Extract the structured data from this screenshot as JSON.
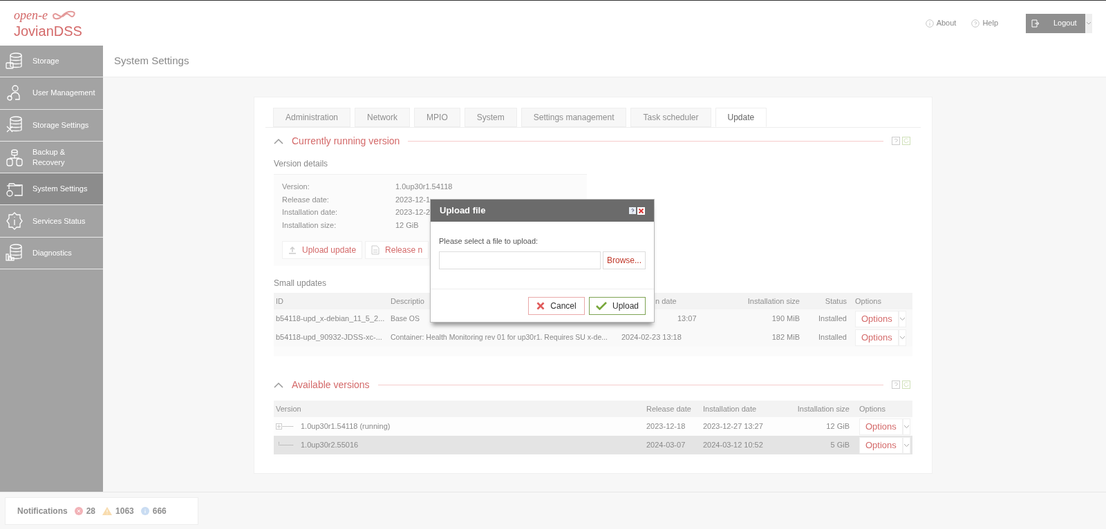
{
  "header": {
    "logo_top": "open-e",
    "logo_bottom": "JovianDSS",
    "links": [
      {
        "label": "About"
      },
      {
        "label": "Help"
      }
    ],
    "logout": "Logout"
  },
  "sidebar": {
    "items": [
      {
        "label": "Storage",
        "selected": false
      },
      {
        "label": "User Management",
        "selected": false
      },
      {
        "label": "Storage Settings",
        "selected": false
      },
      {
        "label": "Backup & Recovery",
        "selected": false
      },
      {
        "label": "System Settings",
        "selected": true
      },
      {
        "label": "Services Status",
        "selected": false
      },
      {
        "label": "Diagnostics",
        "selected": false
      }
    ]
  },
  "page_title": "System Settings",
  "tabs": [
    {
      "label": "Administration",
      "selected": false
    },
    {
      "label": "Network",
      "selected": false
    },
    {
      "label": "MPIO",
      "selected": false
    },
    {
      "label": "System",
      "selected": false
    },
    {
      "label": "Settings management",
      "selected": false
    },
    {
      "label": "Task scheduler",
      "selected": false
    },
    {
      "label": "Update",
      "selected": true
    }
  ],
  "running_section": {
    "title": "Currently running version",
    "expanded": true
  },
  "version_details": {
    "title": "Version details",
    "rows": [
      {
        "label": "Version:",
        "value": "1.0up30r1.54118"
      },
      {
        "label": "Release date:",
        "value": "2023-12-1"
      },
      {
        "label": "Installation date:",
        "value": "2023-12-2"
      },
      {
        "label": "Installation size:",
        "value": "12 GiB"
      }
    ],
    "buttons": [
      "Upload update",
      "Release n"
    ]
  },
  "small_updates": {
    "title": "Small updates",
    "columns": [
      "ID",
      "Descriptio",
      "n date",
      "Installation size",
      "Status",
      "Options"
    ],
    "rows": [
      {
        "id": "b54118-upd_x-debian_11_5_2...",
        "description": "Base OS",
        "installation_date": "13:07",
        "size": "190 MiB",
        "status": "Installed",
        "options": "Options"
      },
      {
        "id": "b54118-upd_90932-JDSS-xc-...",
        "description": "Container: Health Monitoring rev 01 for up30r1. Requires SU x-de...",
        "installation_date": "2024-02-23 13:18",
        "size": "182 MiB",
        "status": "Installed",
        "options": "Options"
      }
    ]
  },
  "available_section": {
    "title": "Available versions",
    "expanded": true
  },
  "available_versions": {
    "columns": [
      "Version",
      "Release date",
      "Installation date",
      "Installation size",
      "Options"
    ],
    "rows": [
      {
        "version": "1.0up30r1.54118 (running)",
        "release_date": "2023-12-18",
        "installation_date": "2023-12-27 13:27",
        "size": "12 GiB",
        "options": "Options",
        "expandable": true,
        "selected": false
      },
      {
        "version": "1.0up30r2.55016",
        "release_date": "2024-03-07",
        "installation_date": "2024-03-12 10:52",
        "size": "5 GiB",
        "options": "Options",
        "expandable": false,
        "selected": true
      }
    ]
  },
  "dialog": {
    "title": "Upload file",
    "label": "Please select a file to upload:",
    "browse": "Browse...",
    "cancel": "Cancel",
    "upload": "Upload"
  },
  "notifications": {
    "label": "Notifications",
    "counts": [
      {
        "kind": "error",
        "count": "28"
      },
      {
        "kind": "warning",
        "count": "1063"
      },
      {
        "kind": "info",
        "count": "666"
      }
    ]
  }
}
